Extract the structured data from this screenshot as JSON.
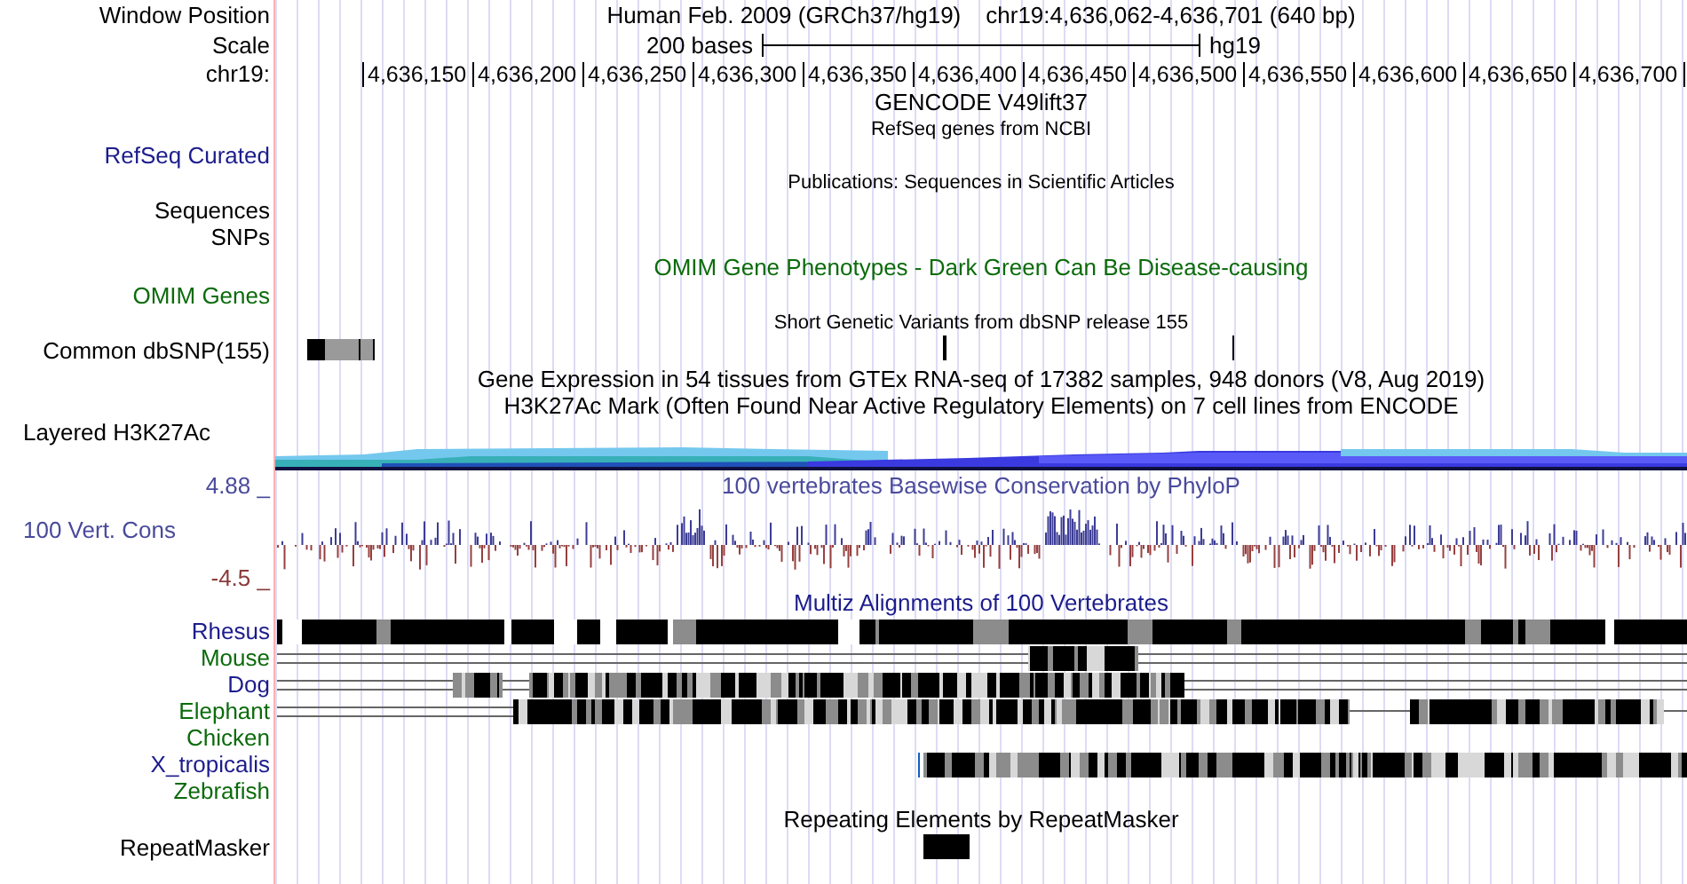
{
  "window_position": {
    "label": "Window Position",
    "assembly": "Human Feb. 2009 (GRCh37/hg19)",
    "range": "chr19:4,636,062-4,636,701 (640 bp)"
  },
  "scale": {
    "label": "Scale",
    "length": "200 bases",
    "assembly": "hg19"
  },
  "ruler": {
    "label": "chr19:",
    "ticks": [
      "4,636,150",
      "4,636,200",
      "4,636,250",
      "4,636,300",
      "4,636,350",
      "4,636,400",
      "4,636,450",
      "4,636,500",
      "4,636,550",
      "4,636,600",
      "4,636,650",
      "4,636,700"
    ]
  },
  "gencode": {
    "title": "GENCODE V49lift37"
  },
  "refseq": {
    "title": "RefSeq genes from NCBI",
    "label": "RefSeq Curated"
  },
  "publications": {
    "title": "Publications: Sequences in Scientific Articles"
  },
  "sequences": {
    "label": "Sequences"
  },
  "snps": {
    "label": "SNPs"
  },
  "omim": {
    "title": "OMIM Gene Phenotypes - Dark Green Can Be Disease-causing",
    "label": "OMIM Genes"
  },
  "dbsnp": {
    "title": "Short Genetic Variants from dbSNP release 155",
    "label": "Common dbSNP(155)"
  },
  "gtex": {
    "title": "Gene Expression in 54 tissues from GTEx RNA-seq of 17382 samples, 948 donors (V8, Aug 2019)"
  },
  "h3k27ac": {
    "title": "H3K27Ac Mark (Often Found Near Active Regulatory Elements) on 7 cell lines from ENCODE",
    "label": "Layered H3K27Ac"
  },
  "conservation": {
    "title": "100 vertebrates Basewise Conservation by PhyloP",
    "label": "100 Vert. Cons",
    "max": "4.88 _",
    "min": "-4.5 _"
  },
  "multiz": {
    "title": "Multiz Alignments of 100 Vertebrates",
    "species": [
      {
        "name": "Rhesus",
        "color": "#1c1c8c"
      },
      {
        "name": "Mouse",
        "color": "#0b6b0b"
      },
      {
        "name": "Dog",
        "color": "#1c1c8c"
      },
      {
        "name": "Elephant",
        "color": "#0b6b0b"
      },
      {
        "name": "Chicken",
        "color": "#0b6b0b"
      },
      {
        "name": "X_tropicalis",
        "color": "#1c1c8c"
      },
      {
        "name": "Zebrafish",
        "color": "#0b6b0b"
      }
    ]
  },
  "repeatmasker": {
    "title": "Repeating Elements by RepeatMasker",
    "label": "RepeatMasker"
  }
}
